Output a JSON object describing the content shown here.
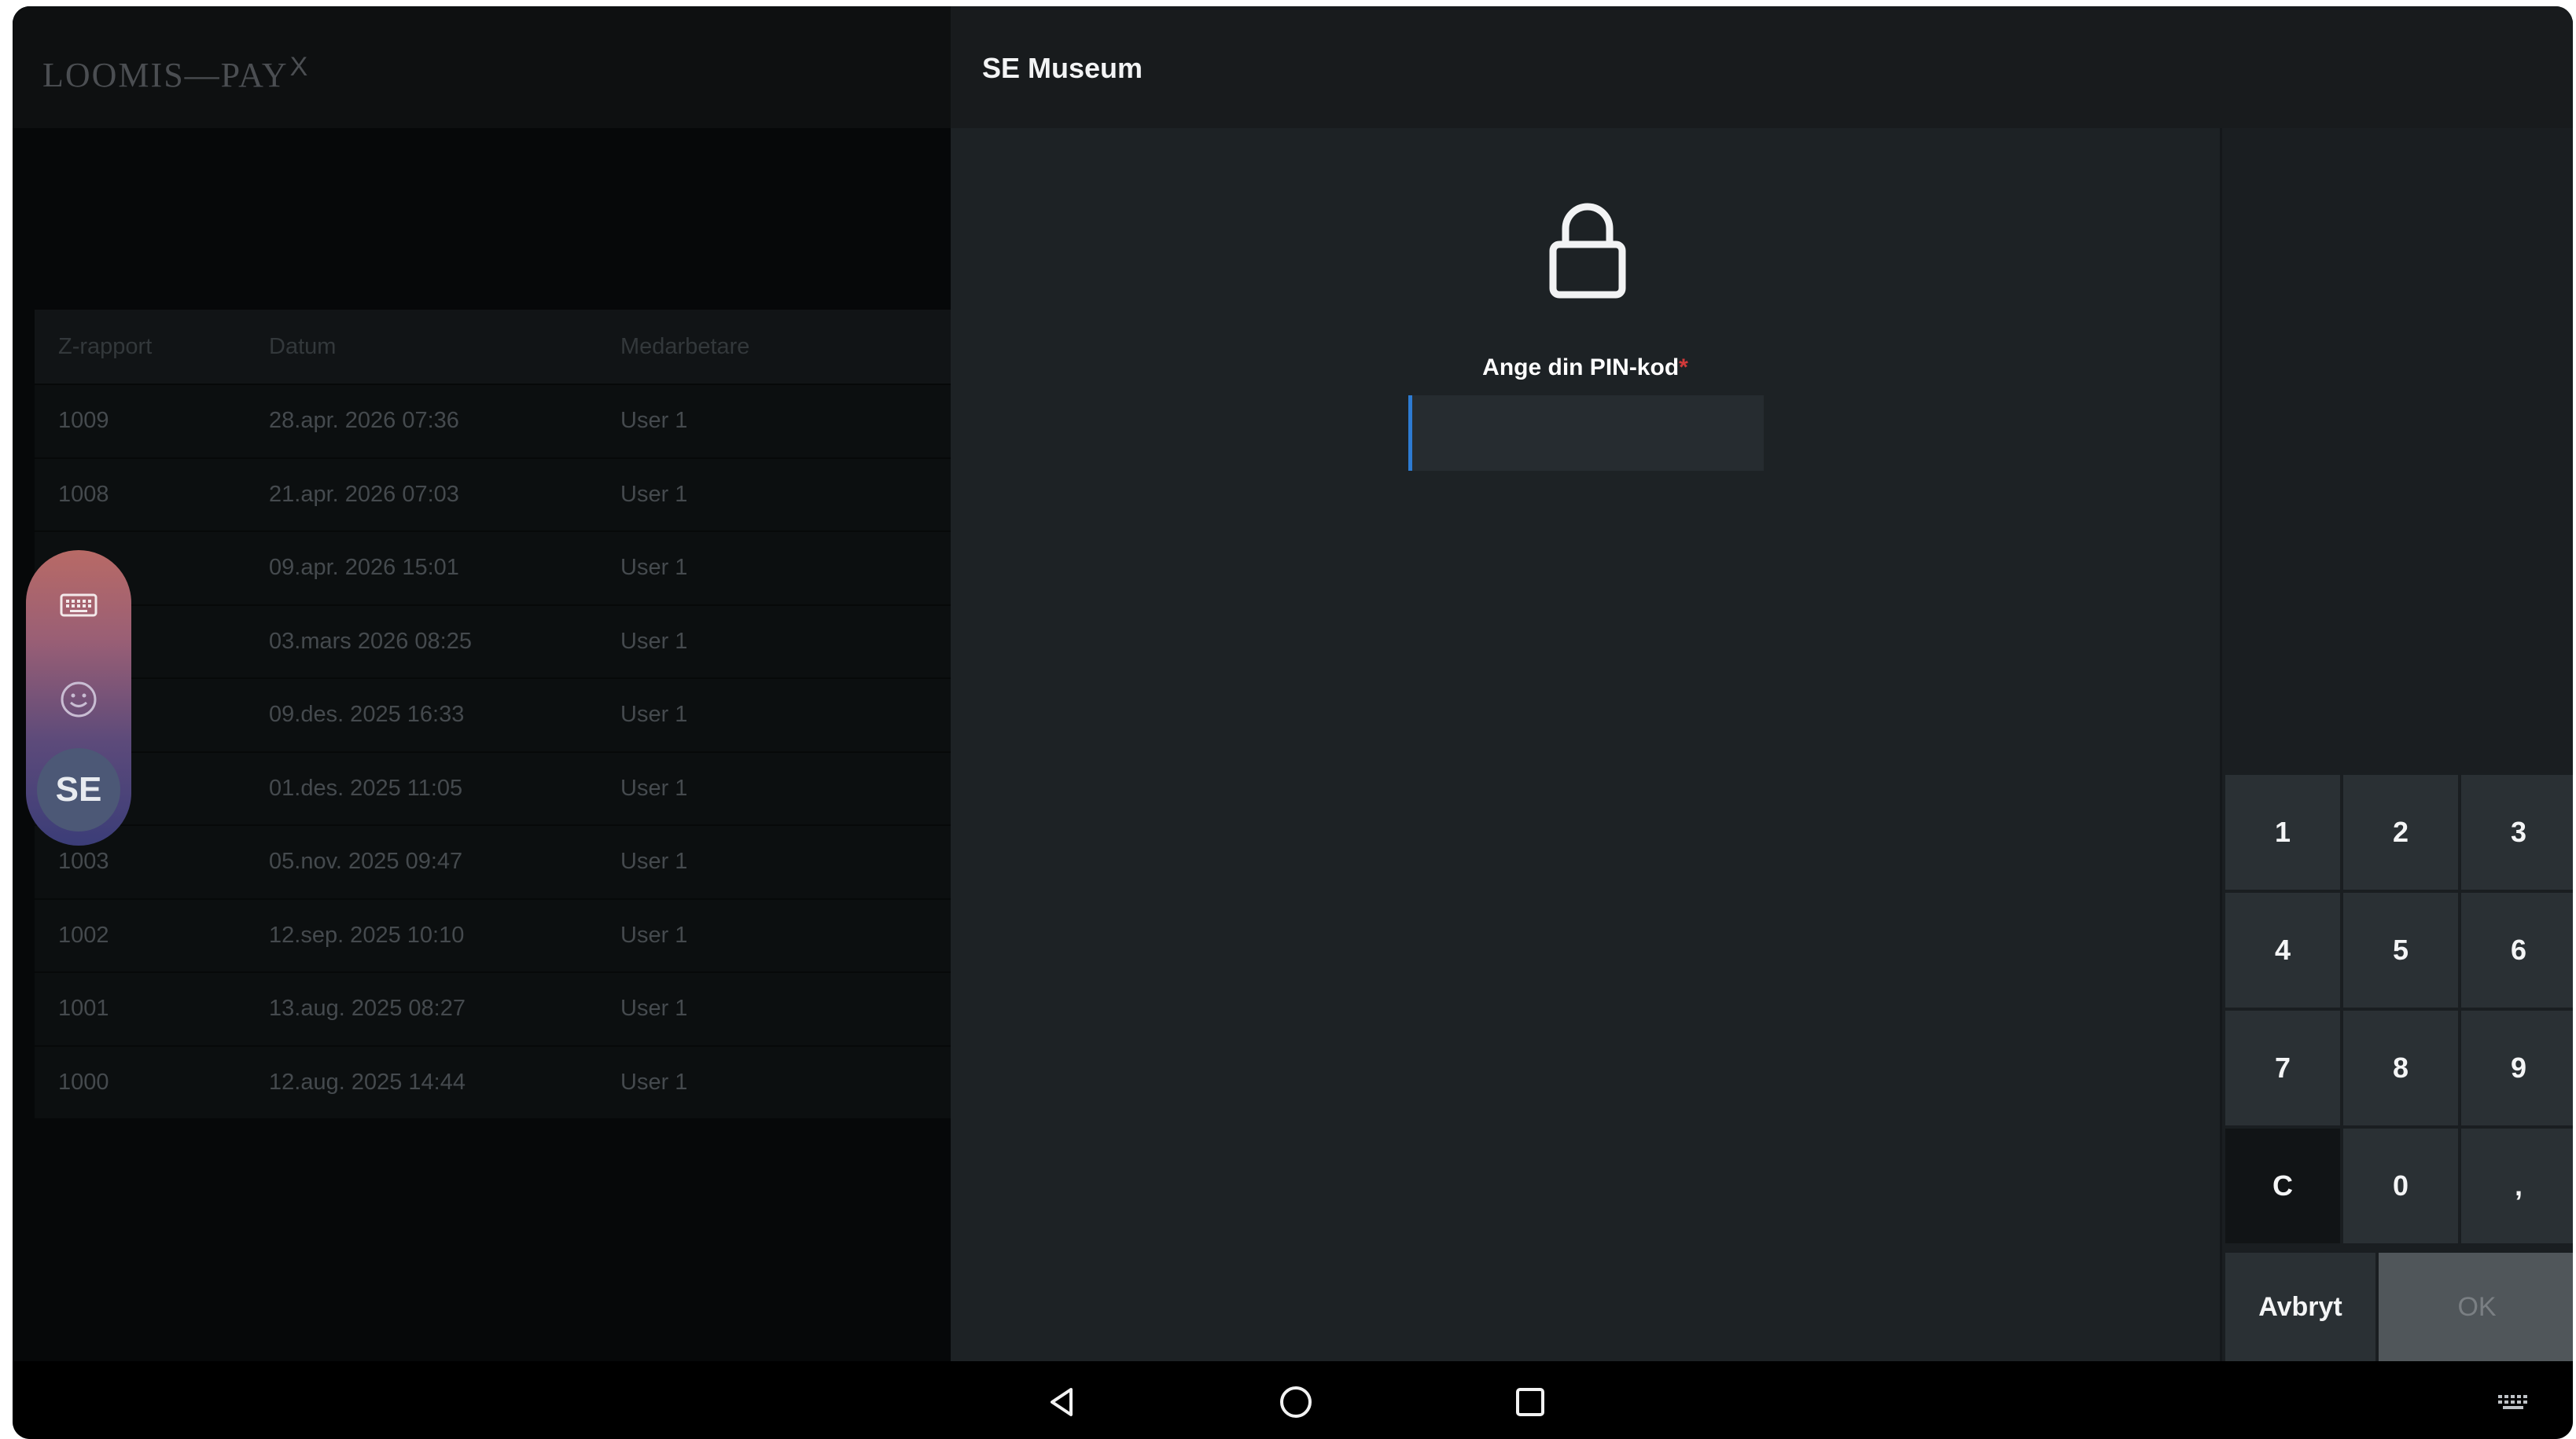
{
  "left": {
    "logo": {
      "text": "LOOMIS—PAY",
      "superscript": "X"
    },
    "table": {
      "headers": [
        "Z-rapport",
        "Datum",
        "Medarbetare"
      ],
      "rows": [
        [
          "1009",
          "28.apr. 2026 07:36",
          "User 1"
        ],
        [
          "1008",
          "21.apr. 2026 07:03",
          "User 1"
        ],
        [
          "",
          "09.apr. 2026 15:01",
          "User 1"
        ],
        [
          "",
          "03.mars 2026 08:25",
          "User 1"
        ],
        [
          "",
          "09.des. 2025 16:33",
          "User 1"
        ],
        [
          "",
          "01.des. 2025 11:05",
          "User 1"
        ],
        [
          "1003",
          "05.nov. 2025 09:47",
          "User 1"
        ],
        [
          "1002",
          "12.sep. 2025 10:10",
          "User 1"
        ],
        [
          "1001",
          "13.aug. 2025 08:27",
          "User 1"
        ],
        [
          "1000",
          "12.aug. 2025 14:44",
          "User 1"
        ]
      ]
    },
    "floating_menu": {
      "keyboard_icon": "keyboard-icon",
      "emoji_icon": "emoji-icon",
      "avatar_text": "SE"
    }
  },
  "dialog": {
    "title": "SE Museum",
    "lock_icon": "lock-icon",
    "pin_label": "Ange din PIN-kod",
    "required_marker": "*",
    "pin_value": "",
    "keypad": {
      "keys": [
        "1",
        "2",
        "3",
        "4",
        "5",
        "6",
        "7",
        "8",
        "9",
        "C",
        "0",
        ","
      ],
      "cancel_label": "Avbryt",
      "ok_label": "OK"
    }
  },
  "navbar": {
    "back_icon": "back-triangle-icon",
    "home_icon": "home-circle-icon",
    "recents_icon": "recents-square-icon",
    "keyboard_icon": "keyboard-icon"
  },
  "colors": {
    "dialog_bg": "#1d2225",
    "key_bg": "#2a3034",
    "accent": "#2d7bd2",
    "required": "#d23a3a"
  }
}
